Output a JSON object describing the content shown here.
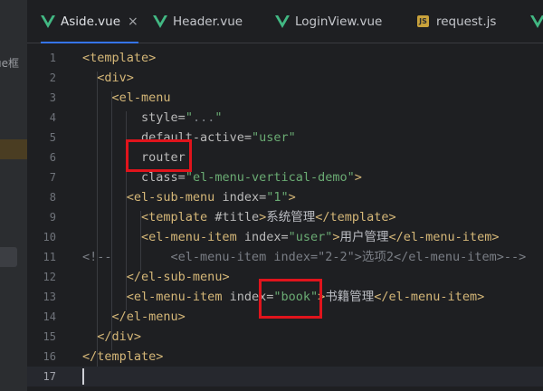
{
  "sidebar": {
    "partial_text": "ue框",
    "colors": {
      "highlight": "#4a3d22",
      "selected": "#3c3e43"
    }
  },
  "tabs": [
    {
      "label": "Aside.vue",
      "icon": "vue-icon",
      "active": true,
      "closable": true
    },
    {
      "label": "Header.vue",
      "icon": "vue-icon",
      "active": false
    },
    {
      "label": "LoginView.vue",
      "icon": "vue-icon",
      "active": false
    },
    {
      "label": "request.js",
      "icon": "js-icon",
      "active": false
    },
    {
      "label": "",
      "icon": "vue-icon",
      "active": false
    }
  ],
  "tab_close_glyph": "×",
  "js_icon_text": "JS",
  "editor": {
    "current_line": 17,
    "lines": [
      {
        "num": "1",
        "segments": [
          [
            "t",
            "<template>"
          ]
        ]
      },
      {
        "num": "2",
        "segments": [
          [
            "p",
            "  "
          ],
          [
            "t",
            "<div>"
          ]
        ]
      },
      {
        "num": "3",
        "segments": [
          [
            "p",
            "    "
          ],
          [
            "t",
            "<el-menu"
          ]
        ]
      },
      {
        "num": "4",
        "segments": [
          [
            "p",
            "        "
          ],
          [
            "a",
            "style="
          ],
          [
            "s",
            "\""
          ],
          [
            "c",
            "..."
          ],
          [
            "s",
            "\""
          ]
        ]
      },
      {
        "num": "5",
        "segments": [
          [
            "p",
            "        "
          ],
          [
            "a",
            "default-active="
          ],
          [
            "s",
            "\"user\""
          ]
        ]
      },
      {
        "num": "6",
        "segments": [
          [
            "p",
            "        "
          ],
          [
            "a",
            "router"
          ]
        ]
      },
      {
        "num": "7",
        "segments": [
          [
            "p",
            "        "
          ],
          [
            "a",
            "class="
          ],
          [
            "s",
            "\"el-menu-vertical-demo\""
          ],
          [
            "t",
            ">"
          ]
        ]
      },
      {
        "num": "8",
        "segments": [
          [
            "p",
            "      "
          ],
          [
            "t",
            "<el-sub-menu "
          ],
          [
            "a",
            "index="
          ],
          [
            "s",
            "\"1\""
          ],
          [
            "t",
            ">"
          ]
        ]
      },
      {
        "num": "9",
        "segments": [
          [
            "p",
            "        "
          ],
          [
            "t",
            "<template "
          ],
          [
            "a",
            "#title"
          ],
          [
            "t",
            ">"
          ],
          [
            "p",
            "系统管理"
          ],
          [
            "t",
            "</template>"
          ]
        ]
      },
      {
        "num": "10",
        "segments": [
          [
            "p",
            "        "
          ],
          [
            "t",
            "<el-menu-item "
          ],
          [
            "a",
            "index="
          ],
          [
            "s",
            "\"user\""
          ],
          [
            "t",
            ">"
          ],
          [
            "p",
            "用户管理"
          ],
          [
            "t",
            "</el-menu-item>"
          ]
        ]
      },
      {
        "num": "11",
        "segments": [
          [
            "c",
            "<!--        <el-menu-item index=\"2-2\">选项2</el-menu-item>-->"
          ]
        ]
      },
      {
        "num": "12",
        "segments": [
          [
            "p",
            "      "
          ],
          [
            "t",
            "</el-sub-menu>"
          ]
        ]
      },
      {
        "num": "13",
        "segments": [
          [
            "p",
            "      "
          ],
          [
            "t",
            "<el-menu-item "
          ],
          [
            "a",
            "index="
          ],
          [
            "s",
            "\"book\""
          ],
          [
            "t",
            ">"
          ],
          [
            "p",
            "书籍管理"
          ],
          [
            "t",
            "</el-menu-item>"
          ]
        ]
      },
      {
        "num": "14",
        "segments": [
          [
            "p",
            "    "
          ],
          [
            "t",
            "</el-menu>"
          ]
        ]
      },
      {
        "num": "15",
        "segments": [
          [
            "p",
            "  "
          ],
          [
            "t",
            "</div>"
          ]
        ]
      },
      {
        "num": "16",
        "segments": [
          [
            "t",
            "</template>"
          ]
        ]
      },
      {
        "num": "17",
        "segments": []
      }
    ]
  },
  "colors": {
    "background": "#1e1f22",
    "tag": "#d5b778",
    "string": "#6aab73",
    "comment": "#7a7e85",
    "annotation_box": "#e0141c",
    "accent": "#3574f0",
    "vue_green": "#42b883"
  }
}
